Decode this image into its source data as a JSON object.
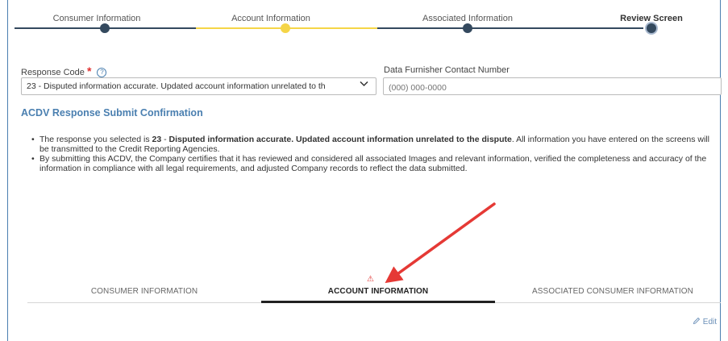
{
  "stepper": {
    "steps": [
      {
        "label": "Consumer Information",
        "state": "complete"
      },
      {
        "label": "Account Information",
        "state": "current-warning"
      },
      {
        "label": "Associated Information",
        "state": "complete"
      },
      {
        "label": "Review Screen",
        "state": "active"
      }
    ]
  },
  "form": {
    "response_code_label": "Response Code",
    "required_mark": "*",
    "help_icon": "?",
    "response_code_value": "23 - Disputed information accurate. Updated account information unrelated to th",
    "contact_label": "Data Furnisher Contact Number",
    "contact_placeholder": "(000) 000-0000"
  },
  "confirmation": {
    "title": "ACDV Response Submit Confirmation",
    "bullet1_prefix": "The response you selected is ",
    "bullet1_code": "23",
    "bullet1_dash": " - ",
    "bullet1_bold": "Disputed information accurate. Updated account information unrelated to the dispute",
    "bullet1_suffix": ". All information you have entered on the screens will be transmitted to the Credit Reporting Agencies.",
    "bullet2": "By submitting this ACDV, the Company certifies that it has reviewed and considered all associated Images and relevant information, verified the completeness and accuracy of the information in compliance with all legal requirements, and adjusted Company records to reflect the data submitted."
  },
  "tabs": {
    "items": [
      "CONSUMER INFORMATION",
      "ACCOUNT INFORMATION",
      "ASSOCIATED CONSUMER INFORMATION"
    ],
    "active_index": 1,
    "warning_glyph": "⚠"
  },
  "edit": {
    "icon": "pencil-icon",
    "label": "Edit"
  },
  "colors": {
    "accent": "#4a7fb0",
    "step_dark": "#34495e",
    "step_warning": "#f5d547",
    "required": "#e0302f",
    "annotation_arrow": "#e53935"
  }
}
